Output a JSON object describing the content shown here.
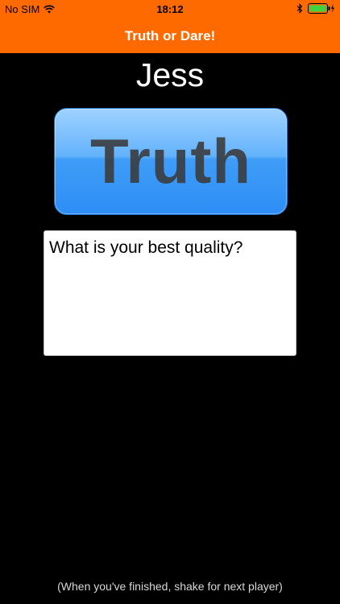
{
  "status_bar": {
    "carrier": "No SIM",
    "time": "18:12",
    "icons": [
      "wifi-icon",
      "bluetooth-icon",
      "battery-charging-icon"
    ]
  },
  "nav": {
    "title": "Truth or Dare!"
  },
  "player": {
    "name": "Jess"
  },
  "mode_button": {
    "label": "Truth"
  },
  "question": {
    "text": "What is your best quality?"
  },
  "footer": {
    "hint": "(When you've finished, shake for next player)"
  },
  "colors": {
    "nav_background": "#ff6a00",
    "background": "#000000",
    "button_blue": "#3f9cf7",
    "battery_green": "#3fd13f"
  }
}
